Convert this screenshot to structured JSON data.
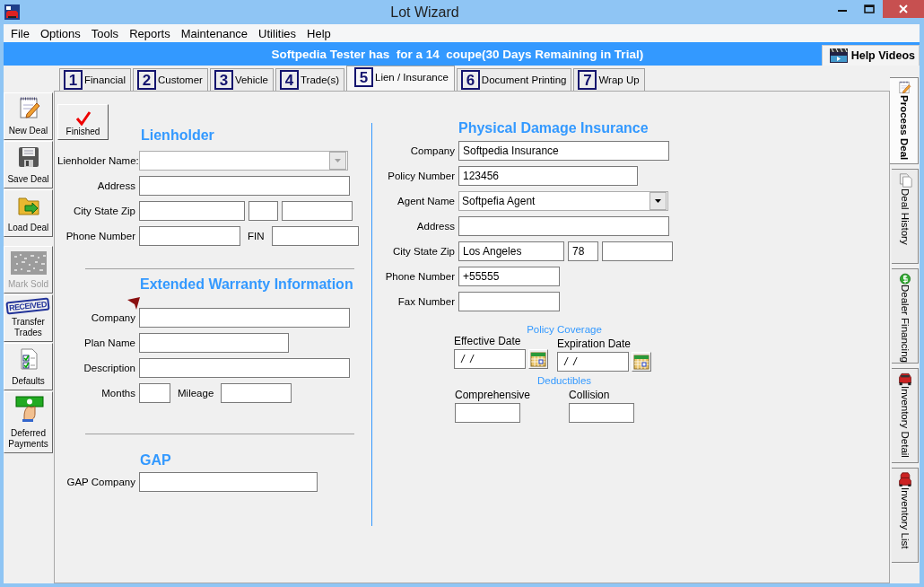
{
  "window": {
    "title": "Lot Wizard"
  },
  "menu": [
    "File",
    "Options",
    "Tools",
    "Reports",
    "Maintenance",
    "Utilities",
    "Help"
  ],
  "banner": {
    "message": "Softpedia Tester has  for a 14  coupe(30 Days Remaining in Trial)",
    "help_button": "Help Videos"
  },
  "sidebar": {
    "groups": [
      [
        {
          "label": "New Deal",
          "kind": "notepad",
          "disabled": false
        },
        {
          "label": "Save Deal",
          "kind": "floppy",
          "disabled": false
        },
        {
          "label": "Load Deal",
          "kind": "folder",
          "disabled": false
        }
      ],
      [
        {
          "label": "Mark Sold",
          "kind": "pattern",
          "disabled": true
        },
        {
          "label": "Transfer Trades",
          "kind": "stamp",
          "icon_text": "RECEIVED",
          "disabled": false
        },
        {
          "label": "Defaults",
          "kind": "checklist",
          "disabled": false
        },
        {
          "label": "Deferred Payments",
          "kind": "money",
          "disabled": false
        }
      ]
    ]
  },
  "tabs": [
    {
      "number": "1",
      "label": "Financial",
      "selected": false
    },
    {
      "number": "2",
      "label": "Customer",
      "selected": false
    },
    {
      "number": "3",
      "label": "Vehicle",
      "selected": false
    },
    {
      "number": "4",
      "label": "Trade(s)",
      "selected": false
    },
    {
      "number": "5",
      "label": "Lien / Insurance",
      "selected": true
    },
    {
      "number": "6",
      "label": "Document Printing",
      "selected": false
    },
    {
      "number": "7",
      "label": "Wrap Up",
      "selected": false
    }
  ],
  "finished_button": "Finished",
  "lienholder": {
    "title": "Lienholder",
    "rows": [
      {
        "kind": "dropdown",
        "label": "Lienholder Name:",
        "disabled": true
      },
      {
        "kind": "text",
        "label": "Address"
      },
      {
        "kind": "split",
        "label": "City State Zip"
      },
      {
        "kind": "pair",
        "label": "Phone Number",
        "second_label": "FIN"
      }
    ]
  },
  "warranty": {
    "title": "Extended Warranty Information",
    "rows": [
      {
        "kind": "text",
        "label": "Company"
      },
      {
        "kind": "text",
        "label": "Plan Name"
      },
      {
        "kind": "text",
        "label": "Description"
      },
      {
        "kind": "pair",
        "label": "Months",
        "second_label": "Mileage"
      }
    ]
  },
  "gap": {
    "title": "GAP",
    "rows": [
      {
        "kind": "text",
        "label": "GAP Company"
      }
    ]
  },
  "insurance": {
    "title": "Physical Damage Insurance",
    "rows": [
      {
        "kind": "text",
        "label": "Company",
        "value": "Softpedia Insurance"
      },
      {
        "kind": "text",
        "label": "Policy Number",
        "value": "123456"
      },
      {
        "kind": "dropdown",
        "label": "Agent Name",
        "value": "Softpefia Agent",
        "disabled": false
      },
      {
        "kind": "text",
        "label": "Address"
      },
      {
        "kind": "split",
        "label": "City State Zip",
        "city": "Los Angeles",
        "state": "78"
      },
      {
        "kind": "text",
        "label": "Phone Number",
        "value": "+55555"
      },
      {
        "kind": "text",
        "label": "Fax Number"
      }
    ],
    "coverage": {
      "title": "Policy Coverage",
      "dates": [
        {
          "label": "Effective Date",
          "value": " /  /"
        },
        {
          "label": "Expiration Date",
          "value": " /  /"
        }
      ]
    },
    "deductibles": {
      "title": "Deductibles",
      "fields": [
        {
          "label": "Comprehensive"
        },
        {
          "label": "Collision"
        }
      ]
    }
  },
  "side_tabs": [
    {
      "label": "Process Deal",
      "kind": "notepad",
      "selected": true
    },
    {
      "label": "Deal History",
      "kind": "pages",
      "selected": false
    },
    {
      "label": "Dealer Financing",
      "kind": "dollar",
      "selected": false
    },
    {
      "label": "Inventory Detail",
      "kind": "car",
      "selected": false
    },
    {
      "label": "Inventory List",
      "kind": "cars",
      "selected": false
    }
  ]
}
